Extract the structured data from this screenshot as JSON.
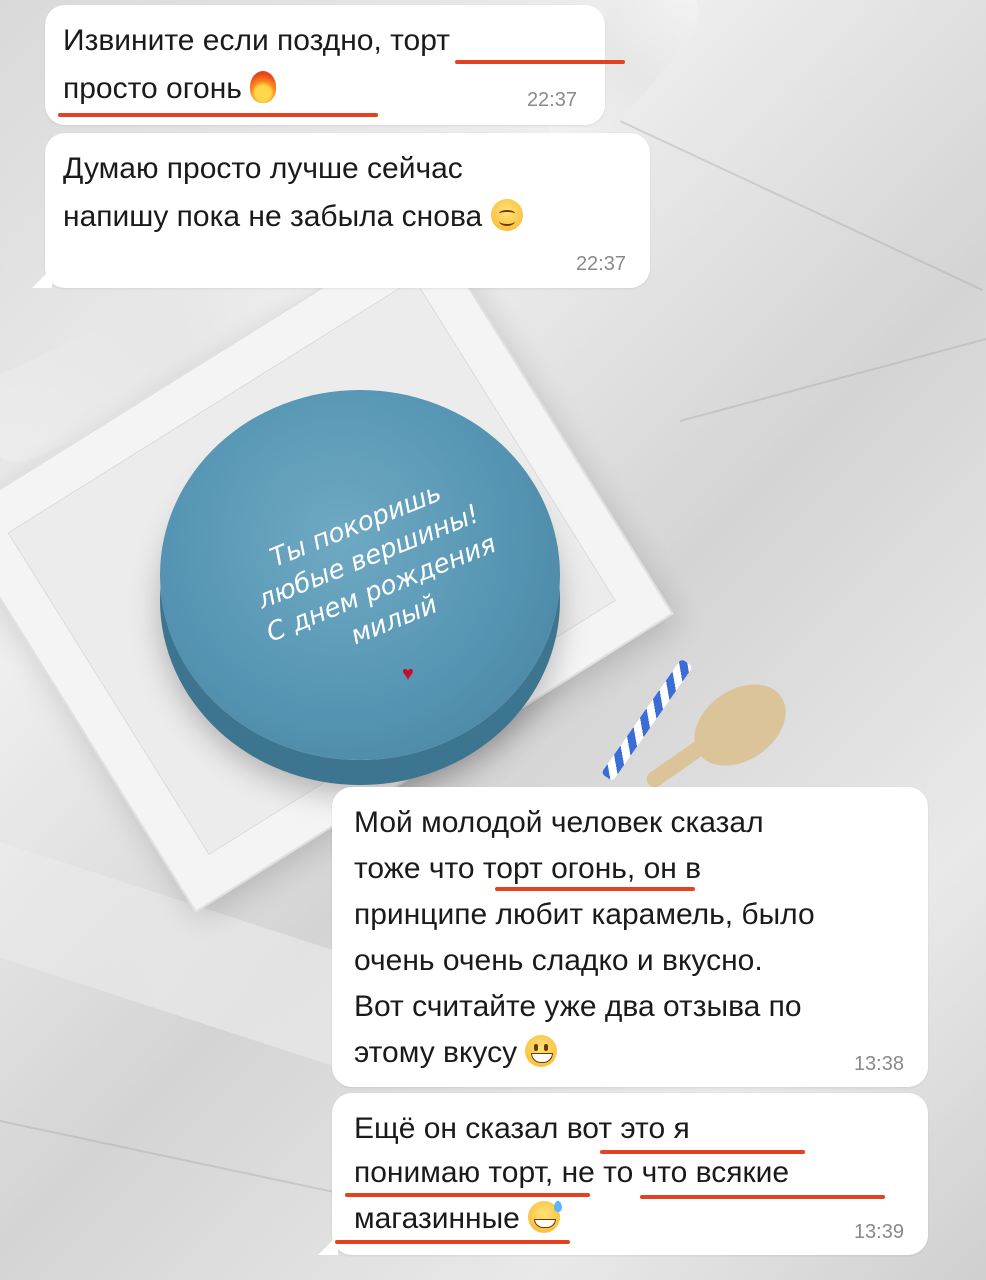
{
  "messages": [
    {
      "lines": [
        "Извините если поздно, торт",
        "просто огонь"
      ],
      "emoji": "fire-emoji",
      "time": "22:37"
    },
    {
      "lines": [
        "Думаю просто лучше сейчас",
        "напишу пока не забыла снова"
      ],
      "emoji": "smiling-face-emoji",
      "time": "22:37"
    },
    {
      "lines": [
        "Мой молодой человек сказал",
        "тоже что торт огонь, он в",
        "принципе любит карамель, было",
        "очень очень сладко и вкусно.",
        "Вот считайте уже два отзыва по",
        "этому вкусу"
      ],
      "emoji": "grinning-face-emoji",
      "time": "13:38"
    },
    {
      "lines": [
        "Ещё он сказал вот это я",
        "понимаю торт, не то что всякие",
        "магазинные"
      ],
      "emoji": "grinning-sweat-emoji",
      "time": "13:39"
    }
  ],
  "cake": {
    "lines": [
      "Ты покоришь",
      "любые вершины!",
      "С днем рождения",
      "милый"
    ]
  },
  "colors": {
    "underline": "#e2421f",
    "bubble": "#ffffff",
    "cake": "#5595b3"
  }
}
